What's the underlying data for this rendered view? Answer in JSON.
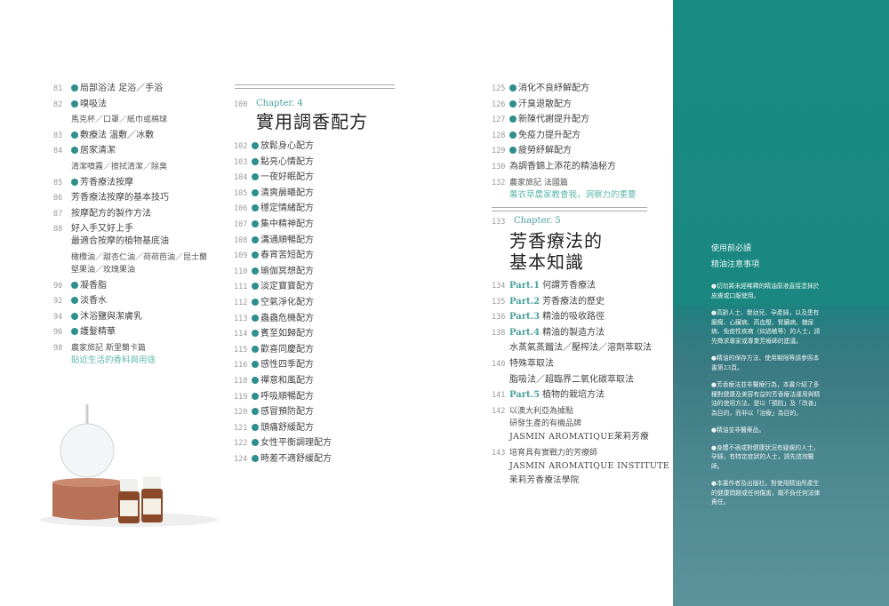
{
  "colors": {
    "accent": "#2f8f8d",
    "green_text": "#5fb7ae",
    "panel": "#178a82"
  },
  "col1": [
    {
      "page": "81",
      "bullet": true,
      "lines": [
        "局部浴法  足浴／手浴"
      ]
    },
    {
      "page": "82",
      "bullet": true,
      "lines": [
        "嗅吸法"
      ]
    },
    {
      "page": "",
      "lines": [
        "馬克杯／口罩／紙巾或棉球"
      ],
      "style": "small"
    },
    {
      "page": "83",
      "bullet": true,
      "lines": [
        "敷療法  溫敷／冰敷"
      ]
    },
    {
      "page": "84",
      "bullet": true,
      "lines": [
        "居家清潔"
      ]
    },
    {
      "page": "",
      "lines": [
        "清潔噴霧／擦拭清潔／除臭"
      ],
      "style": "small"
    },
    {
      "page": "85",
      "bullet": true,
      "lines": [
        "芳香療法按摩"
      ]
    },
    {
      "page": "86",
      "lines": [
        "芳香療法按摩的基本技巧"
      ]
    },
    {
      "page": "87",
      "lines": [
        "按摩配方的製作方法"
      ]
    },
    {
      "page": "88",
      "lines": [
        "好入手又好上手",
        "最適合按摩的植物基底油"
      ]
    },
    {
      "page": "",
      "lines": [
        "橄欖油／甜杏仁油／荷荷芭油／昆士蘭",
        "堅果油／玫瑰果油"
      ],
      "style": "small"
    },
    {
      "page": "90",
      "bullet": true,
      "lines": [
        "凝香脂"
      ]
    },
    {
      "page": "92",
      "bullet": true,
      "lines": [
        "淡香水"
      ]
    },
    {
      "page": "94",
      "bullet": true,
      "lines": [
        "沐浴鹽與潔膚乳"
      ]
    },
    {
      "page": "96",
      "bullet": true,
      "lines": [
        "護髮精華"
      ]
    },
    {
      "page": "98",
      "lines": [
        "農家旅記 斯里蘭卡篇"
      ],
      "green": "貼近生活的香料與用途",
      "style": "small"
    }
  ],
  "chapter4": {
    "page": "100",
    "label": "Chapter. 4",
    "title": "實用調香配方"
  },
  "col2": [
    {
      "page": "102",
      "bullet": true,
      "lines": [
        "放鬆身心配方"
      ]
    },
    {
      "page": "103",
      "bullet": true,
      "lines": [
        "點亮心情配方"
      ]
    },
    {
      "page": "104",
      "bullet": true,
      "lines": [
        "一夜好眠配方"
      ]
    },
    {
      "page": "105",
      "bullet": true,
      "lines": [
        "清爽晨曦配方"
      ]
    },
    {
      "page": "106",
      "bullet": true,
      "lines": [
        "穩定情緒配方"
      ]
    },
    {
      "page": "107",
      "bullet": true,
      "lines": [
        "集中精神配方"
      ]
    },
    {
      "page": "108",
      "bullet": true,
      "lines": [
        "溝通順暢配方"
      ]
    },
    {
      "page": "109",
      "bullet": true,
      "lines": [
        "春宵苦短配方"
      ]
    },
    {
      "page": "110",
      "bullet": true,
      "lines": [
        "瑜伽冥想配方"
      ]
    },
    {
      "page": "111",
      "bullet": true,
      "lines": [
        "淡定寶寶配方"
      ]
    },
    {
      "page": "112",
      "bullet": true,
      "lines": [
        "空氣淨化配方"
      ]
    },
    {
      "page": "113",
      "bullet": true,
      "lines": [
        "蟲蟲危機配方"
      ]
    },
    {
      "page": "114",
      "bullet": true,
      "lines": [
        "賓至如歸配方"
      ]
    },
    {
      "page": "115",
      "bullet": true,
      "lines": [
        "歡喜同慶配方"
      ]
    },
    {
      "page": "116",
      "bullet": true,
      "lines": [
        "感性四季配方"
      ]
    },
    {
      "page": "118",
      "bullet": true,
      "lines": [
        "禪意和風配方"
      ]
    },
    {
      "page": "119",
      "bullet": true,
      "lines": [
        "呼吸順暢配方"
      ]
    },
    {
      "page": "120",
      "bullet": true,
      "lines": [
        "感冒預防配方"
      ]
    },
    {
      "page": "121",
      "bullet": true,
      "lines": [
        "頭痛舒緩配方"
      ]
    },
    {
      "page": "122",
      "bullet": true,
      "lines": [
        "女性平衡調理配方"
      ]
    },
    {
      "page": "124",
      "bullet": true,
      "lines": [
        "時差不適舒緩配方"
      ]
    }
  ],
  "col3a": [
    {
      "page": "125",
      "bullet": true,
      "lines": [
        "消化不良紓解配方"
      ]
    },
    {
      "page": "126",
      "bullet": true,
      "lines": [
        "汗臭退散配方"
      ]
    },
    {
      "page": "127",
      "bullet": true,
      "lines": [
        "新陳代謝提升配方"
      ]
    },
    {
      "page": "128",
      "bullet": true,
      "lines": [
        "免疫力提升配方"
      ]
    },
    {
      "page": "129",
      "bullet": true,
      "lines": [
        "疲勞紓解配方"
      ]
    },
    {
      "page": "130",
      "lines": [
        "為調香錦上添花的精油秘方"
      ]
    },
    {
      "page": "132",
      "lines": [
        "農家旅記 法國篇"
      ],
      "green": "薰衣草農家教會我，洞察力的重要",
      "style": "small"
    }
  ],
  "chapter5": {
    "page": "133",
    "label": "Chapter. 5",
    "title_line1": "芳香療法的",
    "title_line2": "基本知識"
  },
  "col3b": [
    {
      "page": "134",
      "part": "Part.1",
      "lines": [
        "何謂芳香療法"
      ]
    },
    {
      "page": "135",
      "part": "Part.2",
      "lines": [
        "芳香療法的歷史"
      ]
    },
    {
      "page": "136",
      "part": "Part.3",
      "lines": [
        "精油的吸收路徑"
      ]
    },
    {
      "page": "138",
      "part": "Part.4",
      "lines": [
        "精油的製造方法"
      ]
    },
    {
      "page": "",
      "lines": [
        "水蒸氣蒸餾法／壓榨法／溶劑萃取法"
      ]
    },
    {
      "page": "140",
      "lines": [
        "特殊萃取法"
      ]
    },
    {
      "page": "",
      "lines": [
        "脂吸法／超臨界二氧化碳萃取法"
      ]
    },
    {
      "page": "141",
      "part": "Part.5",
      "lines": [
        "植物的栽培方法"
      ]
    },
    {
      "page": "142",
      "lines": [
        "以澳大利亞為據點",
        "研發生產的有機品牌"
      ],
      "en": [
        "JASMIN AROMATIQUE茉莉芳療"
      ],
      "style": "small"
    },
    {
      "page": "143",
      "lines": [
        "培育具有實戰力的芳療師"
      ],
      "en": [
        "JASMIN AROMATIQUE INSTITUTE",
        "茉莉芳香療法學院"
      ],
      "style": "small"
    }
  ],
  "panel": {
    "heading1": "使用前必讀",
    "heading2": "精油注意事項",
    "notes": [
      "切勿將未經稀釋的精油原液直接塗抹於皮膚或口服使用。",
      "高齡人士、嬰幼兒、孕產婦，以及患有癲癇、心臟病、高血壓、腎臟病、糖尿病、免疫性疾病（如過敏等）的人士，請先徵求專家或專業芳療師的建議。",
      "精油的保存方法、使用期限等請參照本書第23頁。",
      "芳香療法並非醫療行為，本書介紹了多種對健康及美容有益的芳香療法運用與精油的使用方法，是以「預防」及「改善」為目的，而非以「治療」為目的。",
      "精油並非醫藥品。",
      "身體不適或對健康狀況有疑慮的人士，孕婦，有特定症狀的人士，請先諮詢醫師。",
      "本書作者及出版社，對使用精油所產生的健康問題或任何傷害，概不負任何法律責任。"
    ]
  }
}
